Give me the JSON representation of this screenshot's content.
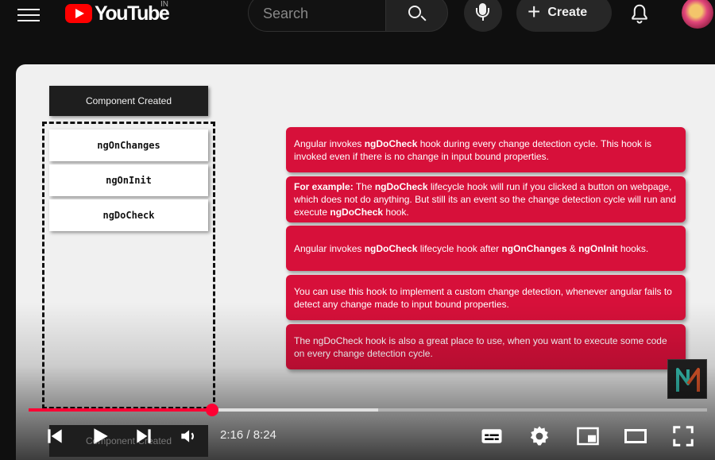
{
  "header": {
    "logo_text": "YouTube",
    "region": "IN",
    "search_placeholder": "Search",
    "create_label": "Create"
  },
  "slide": {
    "header_box": "Component Created",
    "hooks": [
      "ngOnChanges",
      "ngOnInit",
      "ngDoCheck"
    ],
    "cards": [
      {
        "parts": [
          [
            "t",
            "Angular invokes "
          ],
          [
            "b",
            "ngDoCheck"
          ],
          [
            "t",
            " hook during every change detection cycle. This hook is invoked even if there is no change in input bound properties."
          ]
        ]
      },
      {
        "parts": [
          [
            "b",
            "For example:"
          ],
          [
            "t",
            " The "
          ],
          [
            "b",
            "ngDoCheck"
          ],
          [
            "t",
            " lifecycle hook will run if you clicked a button on webpage, which does not do anything. But still its an event so the change detection cycle will run and execute "
          ],
          [
            "b",
            "ngDoCheck"
          ],
          [
            "t",
            " hook."
          ]
        ]
      },
      {
        "parts": [
          [
            "t",
            "Angular invokes "
          ],
          [
            "b",
            "ngDoCheck"
          ],
          [
            "t",
            " lifecycle hook after "
          ],
          [
            "b",
            "ngOnChanges"
          ],
          [
            "t",
            " & "
          ],
          [
            "b",
            "ngOnInit"
          ],
          [
            "t",
            " hooks."
          ]
        ]
      },
      {
        "parts": [
          [
            "t",
            "You can use this hook to implement a custom change detection, whenever angular fails to detect any change made to input bound properties."
          ]
        ]
      },
      {
        "parts": [
          [
            "t",
            "The ngDoCheck hook is also a great place to use, when you want to execute some code on every change detection cycle."
          ]
        ]
      }
    ]
  },
  "player": {
    "time_display": "2:16 / 8:24",
    "progress_fraction": 0.27,
    "buffered_fraction": 0.515,
    "accent_color": "#ff0033",
    "icons": [
      "previous-icon",
      "play-icon",
      "next-icon",
      "volume-icon",
      "subtitles-icon",
      "settings-icon",
      "miniplayer-icon",
      "theater-mode-icon",
      "fullscreen-icon"
    ]
  },
  "colors": {
    "card_red": "#d7103a",
    "header_bg": "#0f0f0f"
  }
}
